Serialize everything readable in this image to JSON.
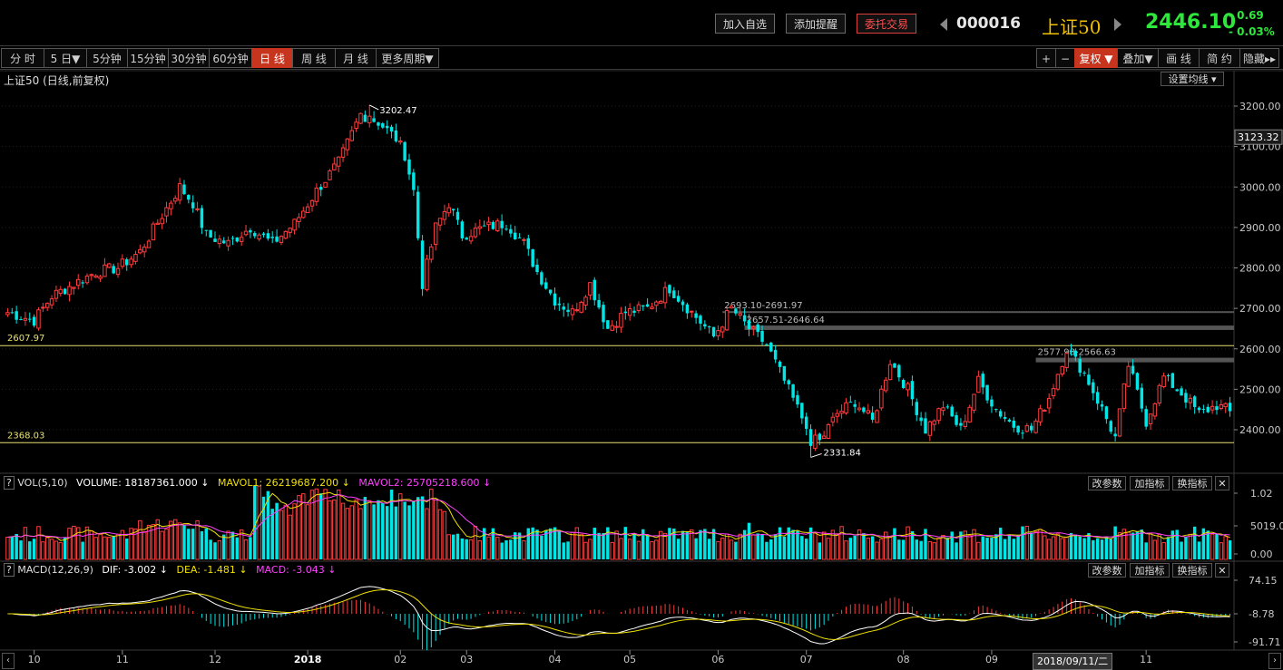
{
  "toolbar": {
    "add_watchlist": "加入自选",
    "add_alert": "添加提醒",
    "trade": "委托交易",
    "code": "000016",
    "name": "上证50",
    "price": "2446.10",
    "change": "- 0.69",
    "change_pct": "- 0.03%"
  },
  "periods": [
    {
      "label": "分 时"
    },
    {
      "label": "5 日▼"
    },
    {
      "label": "5分钟"
    },
    {
      "label": "15分钟"
    },
    {
      "label": "30分钟"
    },
    {
      "label": "60分钟"
    },
    {
      "label": "日 线",
      "active": true
    },
    {
      "label": "周 线"
    },
    {
      "label": "月 线"
    },
    {
      "label": "更多周期▼"
    }
  ],
  "right_tools": [
    {
      "label": "+"
    },
    {
      "label": "−"
    },
    {
      "label": "复权 ▼",
      "active": true
    },
    {
      "label": "叠加▼"
    },
    {
      "label": "画 线"
    },
    {
      "label": "简 约"
    },
    {
      "label": "隐藏▸▸"
    }
  ],
  "main_panel": {
    "title": "上证50 (日线,前复权)",
    "ma_button": "设置均线 ▾",
    "price_tag": "3123.32",
    "high_label": "3202.47",
    "low_label": "2331.84",
    "line1_label": "2607.97",
    "line2_label": "2368.03",
    "gap1_label": "2693.10-2691.97",
    "gap2_label": "2657.51-2646.64",
    "gap3_label": "2577.98-2566.63"
  },
  "vol_panel": {
    "title": "VOL(5,10)",
    "volume": "VOLUME: 18187361.000",
    "mavol1": "MAVOL1: 26219687.200",
    "mavol2": "MAVOL2: 25705218.600",
    "btn1": "改参数",
    "btn2": "加指标",
    "btn3": "换指标"
  },
  "macd_panel": {
    "title": "MACD(12,26,9)",
    "dif": "DIF: -3.002",
    "dea": "DEA: -1.481",
    "macd": "MACD: -3.043",
    "btn1": "改参数",
    "btn2": "加指标",
    "btn3": "换指标"
  },
  "x_axis": {
    "months": [
      {
        "label": "10",
        "index": 6
      },
      {
        "label": "11",
        "index": 26
      },
      {
        "label": "12",
        "index": 47
      },
      {
        "label": "2018",
        "index": 68
      },
      {
        "label": "02",
        "index": 89
      },
      {
        "label": "03",
        "index": 104
      },
      {
        "label": "04",
        "index": 124
      },
      {
        "label": "05",
        "index": 141
      },
      {
        "label": "06",
        "index": 161
      },
      {
        "label": "07",
        "index": 181
      },
      {
        "label": "08",
        "index": 203
      },
      {
        "label": "09",
        "index": 223
      },
      {
        "label": "11",
        "index": 258
      }
    ],
    "cursor_date": "2018/09/11/二"
  },
  "chart_data": {
    "type": "candlestick",
    "y_ticks": [
      2400,
      2500,
      2600,
      2700,
      2800,
      2900,
      3000,
      3100,
      3200
    ],
    "vol_ticks": [
      "1.02",
      "5019.00",
      "0.00"
    ],
    "macd_ticks": [
      "74.15",
      "-8.78",
      "-91.71"
    ],
    "horizontal_lines": [
      2607.97,
      2368.03
    ],
    "gaps": [
      [
        2691.97,
        2693.1
      ],
      [
        2646.64,
        2657.51
      ],
      [
        2566.63,
        2577.98
      ]
    ],
    "high": 3202.47,
    "low": 2331.84,
    "close_anchors": [
      [
        0,
        2690
      ],
      [
        6,
        2670
      ],
      [
        10,
        2730
      ],
      [
        15,
        2760
      ],
      [
        20,
        2790
      ],
      [
        25,
        2800
      ],
      [
        30,
        2840
      ],
      [
        35,
        2930
      ],
      [
        39,
        3000
      ],
      [
        42,
        2960
      ],
      [
        45,
        2880
      ],
      [
        50,
        2860
      ],
      [
        55,
        2900
      ],
      [
        60,
        2860
      ],
      [
        65,
        2910
      ],
      [
        70,
        2990
      ],
      [
        75,
        3060
      ],
      [
        80,
        3180
      ],
      [
        84,
        3160
      ],
      [
        88,
        3120
      ],
      [
        90,
        3080
      ],
      [
        92,
        2990
      ],
      [
        94,
        2760
      ],
      [
        97,
        2900
      ],
      [
        100,
        2960
      ],
      [
        103,
        2880
      ],
      [
        108,
        2900
      ],
      [
        113,
        2910
      ],
      [
        117,
        2860
      ],
      [
        120,
        2790
      ],
      [
        124,
        2720
      ],
      [
        128,
        2690
      ],
      [
        132,
        2760
      ],
      [
        136,
        2650
      ],
      [
        140,
        2690
      ],
      [
        145,
        2700
      ],
      [
        150,
        2750
      ],
      [
        155,
        2690
      ],
      [
        160,
        2630
      ],
      [
        164,
        2700
      ],
      [
        168,
        2650
      ],
      [
        172,
        2610
      ],
      [
        176,
        2520
      ],
      [
        180,
        2430
      ],
      [
        184,
        2370
      ],
      [
        188,
        2440
      ],
      [
        192,
        2470
      ],
      [
        196,
        2420
      ],
      [
        200,
        2570
      ],
      [
        204,
        2500
      ],
      [
        208,
        2400
      ],
      [
        212,
        2460
      ],
      [
        216,
        2400
      ],
      [
        220,
        2520
      ],
      [
        224,
        2450
      ],
      [
        228,
        2410
      ],
      [
        232,
        2400
      ],
      [
        236,
        2480
      ],
      [
        240,
        2600
      ],
      [
        244,
        2540
      ],
      [
        248,
        2450
      ],
      [
        251,
        2380
      ],
      [
        254,
        2560
      ],
      [
        258,
        2420
      ],
      [
        262,
        2530
      ],
      [
        266,
        2490
      ],
      [
        270,
        2440
      ],
      [
        274,
        2460
      ],
      [
        277,
        2446
      ]
    ]
  }
}
